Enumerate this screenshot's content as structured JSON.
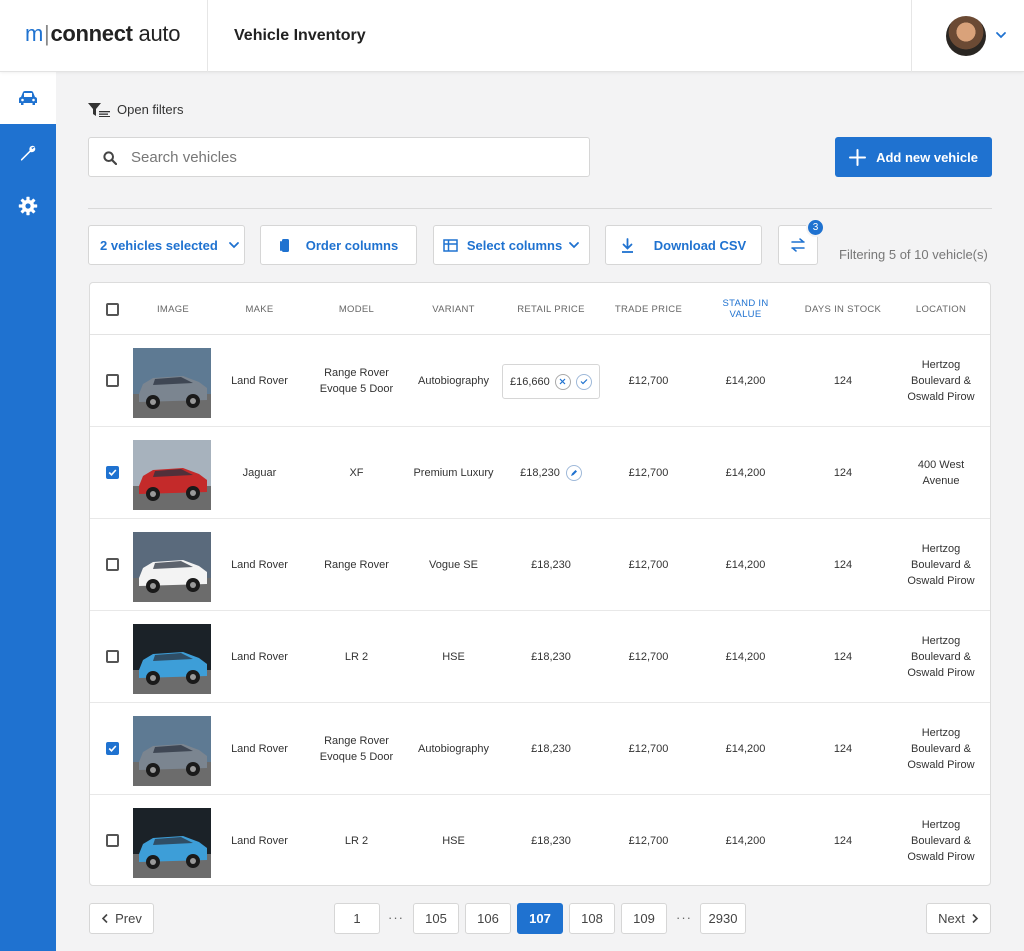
{
  "app": {
    "logo_m": "m",
    "logo_bar": "|",
    "logo_connect": "connect",
    "logo_auto": " auto",
    "page_title": "Vehicle Inventory"
  },
  "colors": {
    "brand": "#1f72d0"
  },
  "sidebar": {
    "items": [
      {
        "icon": "car-icon",
        "active": true
      },
      {
        "icon": "wrench-icon",
        "active": false
      },
      {
        "icon": "gear-icon",
        "active": false
      }
    ]
  },
  "filters": {
    "open_label": "Open filters"
  },
  "search": {
    "placeholder": "Search vehicles",
    "value": ""
  },
  "actions": {
    "add_label": "Add new vehicle"
  },
  "toolbar": {
    "selected_label": "2 vehicles selected",
    "order_label": "Order columns",
    "select_label": "Select columns",
    "download_label": "Download CSV",
    "compare_badge": "3",
    "status": "Filtering 5 of 10 vehicle(s)"
  },
  "table": {
    "headers": {
      "image": "IMAGE",
      "make": "MAKE",
      "model": "MODEL",
      "variant": "VARIANT",
      "retail": "RETAIL PRICE",
      "trade": "TRADE PRICE",
      "stand_in_1": "STAND IN",
      "stand_in_2": "VALUE",
      "days": "DAYS IN STOCK",
      "location": "LOCATION"
    },
    "rows": [
      {
        "checked": false,
        "car_color": "grey",
        "make": "Land Rover",
        "model_1": "Range Rover",
        "model_2": "Evoque 5 Door",
        "variant": "Autobiography",
        "retail": "£16,660",
        "editing": true,
        "retail_saved": false,
        "trade": "£12,700",
        "stand_in": "£14,200",
        "days": "124",
        "loc_1": "Hertzog",
        "loc_2": "Boulevard &",
        "loc_3": "Oswald Pirow"
      },
      {
        "checked": true,
        "car_color": "red",
        "make": "Jaguar",
        "model_1": "XF",
        "model_2": "",
        "variant": "Premium Luxury",
        "retail": "£18,230",
        "editing": false,
        "retail_saved": true,
        "trade": "£12,700",
        "stand_in": "£14,200",
        "days": "124",
        "loc_1": "400 West",
        "loc_2": "Avenue",
        "loc_3": ""
      },
      {
        "checked": false,
        "car_color": "white",
        "make": "Land Rover",
        "model_1": "Range Rover",
        "model_2": "",
        "variant": "Vogue SE",
        "retail": "£18,230",
        "editing": false,
        "retail_saved": false,
        "trade": "£12,700",
        "stand_in": "£14,200",
        "days": "124",
        "loc_1": "Hertzog",
        "loc_2": "Boulevard &",
        "loc_3": "Oswald Pirow"
      },
      {
        "checked": false,
        "car_color": "blue",
        "make": "Land Rover",
        "model_1": "LR 2",
        "model_2": "",
        "variant": "HSE",
        "retail": "£18,230",
        "editing": false,
        "retail_saved": false,
        "trade": "£12,700",
        "stand_in": "£14,200",
        "days": "124",
        "loc_1": "Hertzog",
        "loc_2": "Boulevard &",
        "loc_3": "Oswald Pirow"
      },
      {
        "checked": true,
        "car_color": "grey",
        "make": "Land Rover",
        "model_1": "Range Rover",
        "model_2": "Evoque 5 Door",
        "variant": "Autobiography",
        "retail": "£18,230",
        "editing": false,
        "retail_saved": false,
        "trade": "£12,700",
        "stand_in": "£14,200",
        "days": "124",
        "loc_1": "Hertzog",
        "loc_2": "Boulevard &",
        "loc_3": "Oswald Pirow"
      },
      {
        "checked": false,
        "car_color": "blue",
        "make": "Land Rover",
        "model_1": "LR 2",
        "model_2": "",
        "variant": "HSE",
        "retail": "£18,230",
        "editing": false,
        "retail_saved": false,
        "trade": "£12,700",
        "stand_in": "£14,200",
        "days": "124",
        "loc_1": "Hertzog",
        "loc_2": "Boulevard &",
        "loc_3": "Oswald Pirow"
      }
    ]
  },
  "pagination": {
    "prev": "Prev",
    "next": "Next",
    "pages": [
      "1",
      "105",
      "106",
      "107",
      "108",
      "109",
      "2930"
    ],
    "current": "107",
    "ellipsis": "···"
  }
}
